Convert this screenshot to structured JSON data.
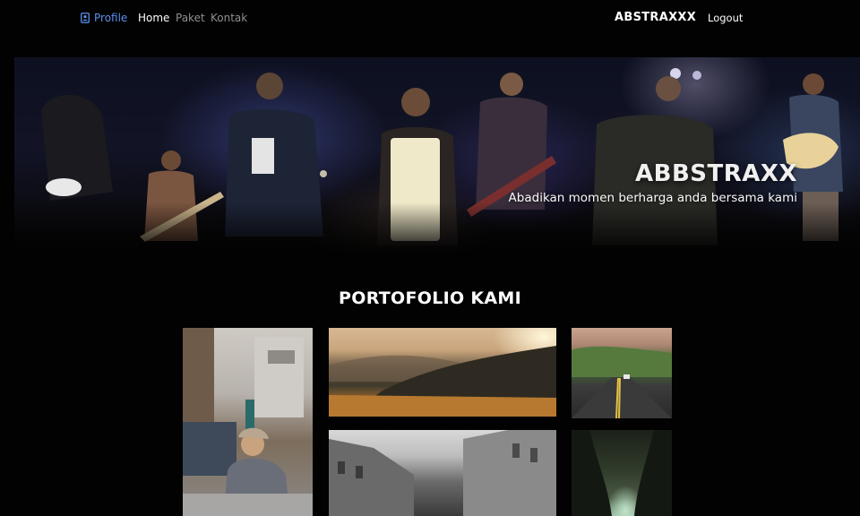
{
  "nav": {
    "profile_label": "Profile",
    "links": [
      "Home",
      "Paket",
      "Kontak"
    ],
    "active_link": "Home",
    "brand": "ABSTRAXXX",
    "logout_label": "Logout"
  },
  "hero": {
    "title": "ABBSTRAXX",
    "subtitle": "Abadikan momen berharga anda bersama kami"
  },
  "portfolio": {
    "title": "PORTOFOLIO KAMI",
    "photos": [
      {
        "subject": "woman in bucket hat crouching on city street"
      },
      {
        "subject": "sunset over mountain hills and golden grass"
      },
      {
        "subject": "winding road through green hills"
      },
      {
        "subject": "black and white European street"
      },
      {
        "subject": "tree tunnel path"
      }
    ]
  },
  "colors": {
    "background": "#020202",
    "profile_accent": "#5b8fef",
    "nav_inactive": "#8f8f8f",
    "text": "#ffffff"
  },
  "icons": {
    "profile": "user-badge-icon"
  }
}
